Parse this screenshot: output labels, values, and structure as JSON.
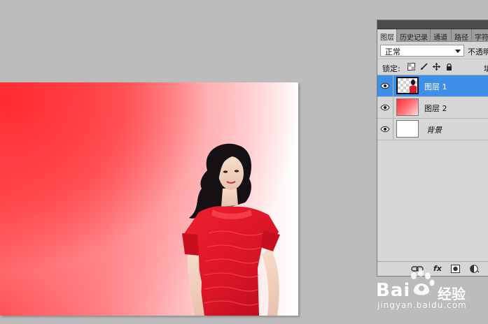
{
  "panel": {
    "tabs": [
      "图层",
      "历史记录",
      "通道",
      "路径",
      "字符"
    ],
    "blend_mode": "正常",
    "opacity_label": "不透明",
    "lock_label": "锁定:",
    "fill_label": "填",
    "layers": [
      {
        "name": "图层 1",
        "selected": true
      },
      {
        "name": "图层 2",
        "selected": false
      },
      {
        "name": "背景",
        "selected": false
      }
    ],
    "bottom_fx_label": "fx"
  },
  "watermark": {
    "brand": "Bai",
    "brand_suffix": "经验",
    "url": "jingyan.baidu.com"
  },
  "colors": {
    "selection": "#3d8ee6",
    "panel_bg": "#d6d6d6",
    "workspace_bg": "#bcbcbc",
    "dress_red": "#e0182a"
  }
}
